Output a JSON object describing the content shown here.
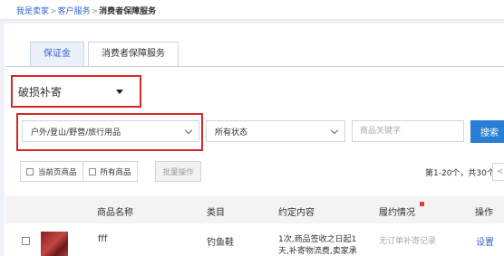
{
  "breadcrumb": {
    "items": [
      "我是卖家",
      "客户服务"
    ],
    "separator": ">",
    "current": "消费者保障服务"
  },
  "tabs": [
    {
      "label": "保证金",
      "active": false
    },
    {
      "label": "消费者保障服务",
      "active": true
    }
  ],
  "filters": {
    "service_type": "破损补寄",
    "category": "户外/登山/野营/旅行用品",
    "status": "所有状态",
    "keyword_placeholder": "商品关键字",
    "keyword_value": "",
    "search_label": "搜索"
  },
  "toolbar": {
    "current_page_label": "当前页商品",
    "all_items_label": "所有商品",
    "batch_label": "批量操作"
  },
  "pager": {
    "summary": "第1-20个，共30个",
    "prev_label": "<"
  },
  "table": {
    "headers": [
      "商品名称",
      "类目",
      "约定内容",
      "履约情况",
      "操作"
    ],
    "rows": [
      {
        "name": "fff",
        "category": "钓鱼鞋",
        "contract_line1": "1次,商品签收之日起1",
        "contract_line2": "天,补寄物流费,卖家承",
        "fulfillment": "无订单补寄记录",
        "action": "设置"
      }
    ]
  },
  "colors": {
    "accent": "#2a7fd4",
    "link": "#3366cc",
    "highlight_border": "#d62828"
  }
}
